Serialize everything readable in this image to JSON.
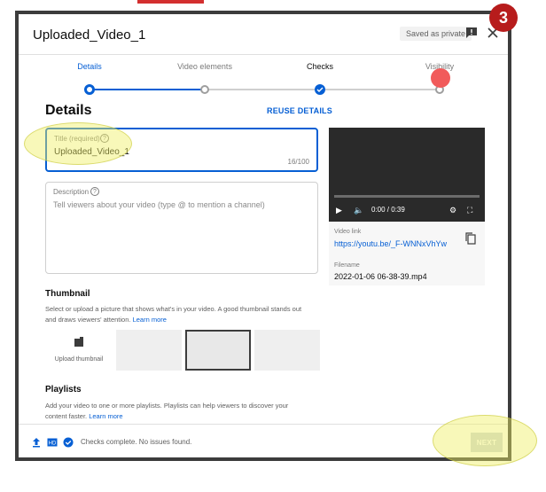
{
  "dialog": {
    "title": "Uploaded_Video_1",
    "saved_badge": "Saved as private"
  },
  "stepper": {
    "steps": [
      {
        "label": "Details",
        "state": "active"
      },
      {
        "label": "Video elements",
        "state": "pending"
      },
      {
        "label": "Checks",
        "state": "done"
      },
      {
        "label": "Visibility",
        "state": "pending"
      }
    ]
  },
  "details": {
    "heading": "Details",
    "reuse_label": "REUSE DETAILS",
    "title_field": {
      "label": "Title (required)",
      "value": "Uploaded_Video_1",
      "counter": "16/100"
    },
    "description_field": {
      "label": "Description",
      "placeholder": "Tell viewers about your video (type @ to mention a channel)"
    }
  },
  "video": {
    "time": "0:00 / 0:39",
    "link_label": "Video link",
    "link": "https://youtu.be/_F-WNNxVhYw",
    "filename_label": "Filename",
    "filename": "2022-01-06 06-38-39.mp4"
  },
  "thumbnail": {
    "heading": "Thumbnail",
    "description": "Select or upload a picture that shows what's in your video. A good thumbnail stands out and draws viewers' attention.",
    "learn_more": "Learn more",
    "upload_label": "Upload thumbnail"
  },
  "playlists": {
    "heading": "Playlists",
    "description": "Add your video to one or more playlists. Playlists can help viewers to discover your content faster.",
    "learn_more": "Learn more"
  },
  "footer": {
    "status": "Checks complete. No issues found.",
    "next_label": "NEXT"
  },
  "annotation": {
    "step_number": "3",
    "badge_color": "#b71c1c",
    "highlight_color": "#f0f064"
  },
  "colors": {
    "accent": "#065fd4",
    "visibility_marker": "#f15b5b"
  }
}
